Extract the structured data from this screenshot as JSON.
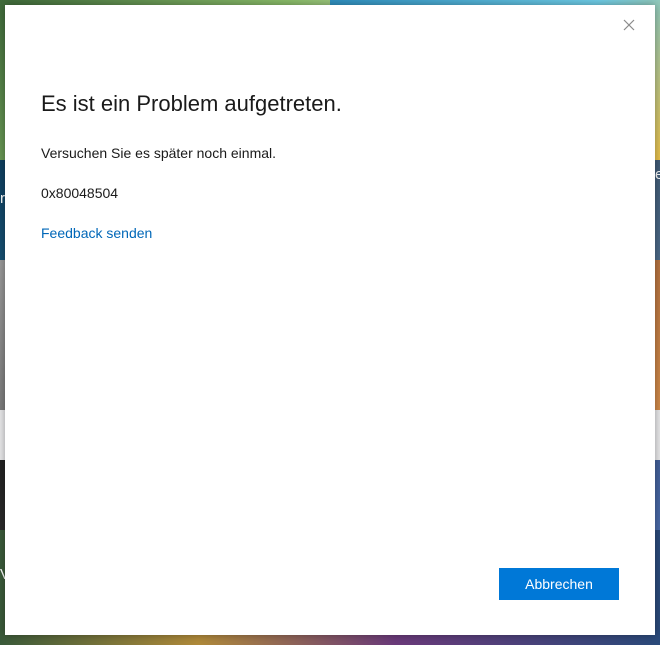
{
  "background": {
    "edge_letters": {
      "left_top": "r",
      "right_top": "e",
      "left_bottom": "V"
    }
  },
  "dialog": {
    "title": "Es ist ein Problem aufgetreten.",
    "message": "Versuchen Sie es später noch einmal.",
    "error_code": "0x80048504",
    "feedback_link": "Feedback senden",
    "cancel_label": "Abbrechen",
    "close_icon": "close-icon"
  },
  "colors": {
    "accent": "#0078d7",
    "link": "#0067b8",
    "text": "#1a1a1a",
    "dialog_bg": "#ffffff"
  }
}
